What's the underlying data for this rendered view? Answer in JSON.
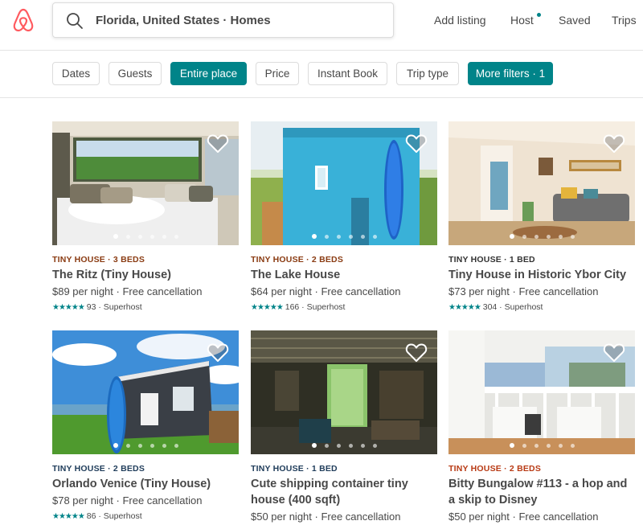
{
  "search": {
    "text": "Florida, United States · Homes"
  },
  "nav": {
    "add_listing": "Add listing",
    "host": "Host",
    "saved": "Saved",
    "trips": "Trips"
  },
  "filters": [
    "Dates",
    "Guests",
    "Entire place",
    "Price",
    "Instant Book",
    "Trip type",
    "More filters · 1"
  ],
  "colors": {
    "brand": "#FF5A5F",
    "accent": "#008489"
  },
  "listings": [
    {
      "kicker": "TINY HOUSE · 3 BEDS",
      "kicker_color": "#8A3B12",
      "title": "The Ritz (Tiny House)",
      "price": "$89 per night · Free cancellation",
      "stars": "★★★★★",
      "reviews": "93 · Superhost",
      "photo_slide": 1
    },
    {
      "kicker": "TINY HOUSE · 2 BEDS",
      "kicker_color": "#8A3B12",
      "title": "The Lake House",
      "price": "$64 per night · Free cancellation",
      "stars": "★★★★★",
      "reviews": "166 · Superhost",
      "photo_slide": 1
    },
    {
      "kicker": "TINY HOUSE · 1 BED",
      "kicker_color": "#333333",
      "title": "Tiny House in Historic Ybor City",
      "price": "$73 per night · Free cancellation",
      "stars": "★★★★★",
      "reviews": "304 · Superhost",
      "photo_slide": 1
    },
    {
      "kicker": "TINY HOUSE · 2 BEDS",
      "kicker_color": "#1F3C5A",
      "title": "Orlando Venice (Tiny House)",
      "price": "$78 per night · Free cancellation",
      "stars": "★★★★★",
      "reviews": "86 · Superhost",
      "photo_slide": 1
    },
    {
      "kicker": "TINY HOUSE · 1 BED",
      "kicker_color": "#1F3C5A",
      "title": "Cute shipping container tiny house (400 sqft)",
      "price": "$50 per night · Free cancellation",
      "stars": "",
      "reviews": "",
      "photo_slide": 1
    },
    {
      "kicker": "TINY HOUSE · 2 BEDS",
      "kicker_color": "#B83A14",
      "title": "Bitty Bungalow #113 - a hop and a skip to Disney",
      "price": "$50 per night · Free cancellation",
      "stars": "",
      "reviews": "",
      "photo_slide": 1
    }
  ]
}
